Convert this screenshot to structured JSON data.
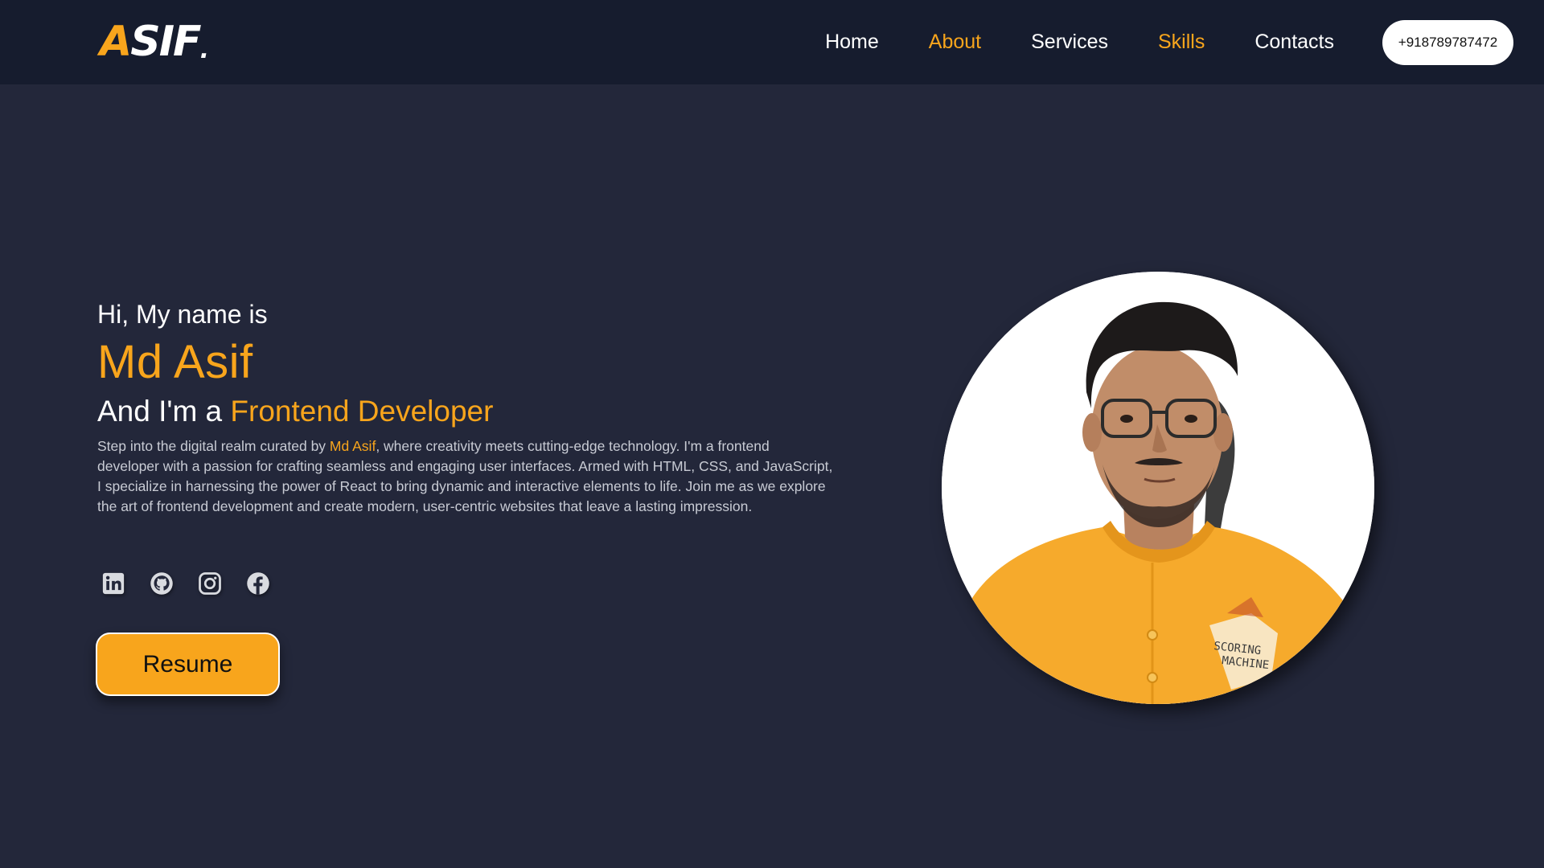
{
  "brand": {
    "logo_text": "ASIF",
    "logo_first": "A",
    "logo_rest": "SIF",
    "logo_dot": ".",
    "accent_color": "#f8a51c",
    "nav_bg": "#161c2e",
    "page_bg": "#23273a"
  },
  "nav": {
    "items": [
      {
        "label": "Home",
        "accent": false
      },
      {
        "label": "About",
        "accent": true
      },
      {
        "label": "Services",
        "accent": false
      },
      {
        "label": "Skills",
        "accent": true
      },
      {
        "label": "Contacts",
        "accent": false
      }
    ],
    "phone": "+918789787472"
  },
  "hero": {
    "greeting": "Hi, My name is",
    "name": "Md Asif",
    "role_prefix": "And I'm a ",
    "role_highlight": "Frontend Developer",
    "intro_before": "Step into the digital realm curated by ",
    "intro_name": "Md Asif",
    "intro_after": ", where creativity meets cutting-edge technology. I'm a frontend developer with a passion for crafting seamless and engaging user interfaces. Armed with HTML, CSS, and JavaScript, I specialize in harnessing the power of React to bring dynamic and interactive elements to life. Join me as we explore the art of frontend development and create modern, user-centric websites that leave a lasting impression.",
    "resume_label": "Resume"
  },
  "socials": [
    {
      "icon": "linkedin-icon"
    },
    {
      "icon": "github-icon"
    },
    {
      "icon": "instagram-icon"
    },
    {
      "icon": "facebook-icon"
    }
  ],
  "profile": {
    "shirt_text_line1": "SCORING",
    "shirt_text_line2": "MACHINE"
  }
}
